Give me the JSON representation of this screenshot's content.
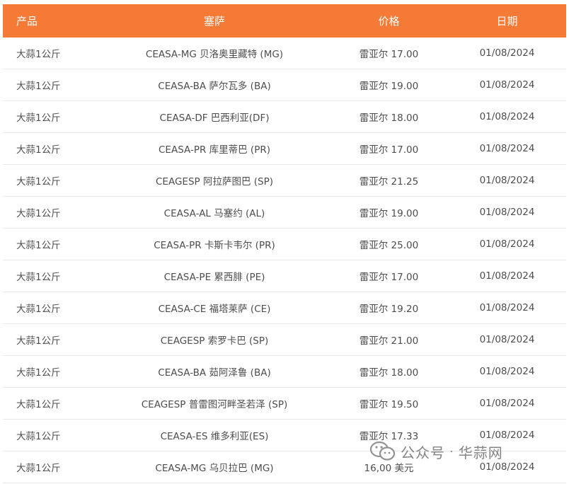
{
  "header": {
    "col_product": "产品",
    "col_ceasa": "塞萨",
    "col_price": "价格",
    "col_date": "日期"
  },
  "rows": [
    {
      "product": "大蒜1公斤",
      "ceasa": "CEASA-MG 贝洛奥里藏特 (MG)",
      "price": "雷亚尔 17.00",
      "date": "01/08/2024"
    },
    {
      "product": "大蒜1公斤",
      "ceasa": "CEASA-BA 萨尔瓦多 (BA)",
      "price": "雷亚尔 19.00",
      "date": "01/08/2024"
    },
    {
      "product": "大蒜1公斤",
      "ceasa": "CEASA-DF 巴西利亚(DF)",
      "price": "雷亚尔 18.00",
      "date": "01/08/2024"
    },
    {
      "product": "大蒜1公斤",
      "ceasa": "CEASA-PR 库里蒂巴 (PR)",
      "price": "雷亚尔 17.00",
      "date": "01/08/2024"
    },
    {
      "product": "大蒜1公斤",
      "ceasa": "CEAGESP 阿拉萨图巴 (SP)",
      "price": "雷亚尔 21.25",
      "date": "01/08/2024"
    },
    {
      "product": "大蒜1公斤",
      "ceasa": "CEASA-AL 马塞约 (AL)",
      "price": "雷亚尔 19.00",
      "date": "01/08/2024"
    },
    {
      "product": "大蒜1公斤",
      "ceasa": "CEASA-PR 卡斯卡韦尔 (PR)",
      "price": "雷亚尔 25.00",
      "date": "01/08/2024"
    },
    {
      "product": "大蒜1公斤",
      "ceasa": "CEASA-PE 累西腓 (PE)",
      "price": "雷亚尔 17.00",
      "date": "01/08/2024"
    },
    {
      "product": "大蒜1公斤",
      "ceasa": "CEASA-CE 福塔莱萨 (CE)",
      "price": "雷亚尔 19.20",
      "date": "01/08/2024"
    },
    {
      "product": "大蒜1公斤",
      "ceasa": "CEAGESP 索罗卡巴 (SP)",
      "price": "雷亚尔 21.00",
      "date": "01/08/2024"
    },
    {
      "product": "大蒜1公斤",
      "ceasa": "CEASA-BA 茹阿泽鲁 (BA)",
      "price": "雷亚尔 18.00",
      "date": "01/08/2024"
    },
    {
      "product": "大蒜1公斤",
      "ceasa": "CEAGESP 普雷图河畔圣若泽 (SP)",
      "price": "雷亚尔 19.50",
      "date": "01/08/2024"
    },
    {
      "product": "大蒜1公斤",
      "ceasa": "CEASA-ES 维多利亚(ES)",
      "price": "雷亚尔 17.33",
      "date": "01/08/2024"
    },
    {
      "product": "大蒜1公斤",
      "ceasa": "CEASA-MG 乌贝拉巴 (MG)",
      "price": "16,00 美元",
      "date": "01/08/2024"
    }
  ],
  "watermark": {
    "icon": "wechat-icon",
    "text_left": "公众号",
    "separator": "·",
    "text_right": "华蒜网"
  },
  "colors": {
    "header_bg": "#f47a36",
    "header_text": "#ffffff",
    "row_border": "#e9e9e9"
  }
}
